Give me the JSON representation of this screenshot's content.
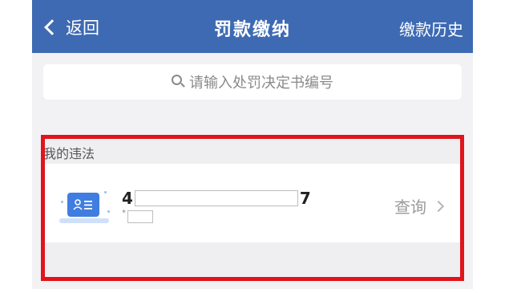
{
  "header": {
    "back_label": "返回",
    "title": "罚款缴纳",
    "history_label": "缴款历史",
    "background_color": "#3e6ab3"
  },
  "search": {
    "placeholder": "请输入处罚决定书编号",
    "icon": "search-icon"
  },
  "violations": {
    "section_title": "我的违法",
    "item": {
      "plate_prefix": "4",
      "plate_suffix": "7",
      "sub_prefix": "*",
      "query_label": "查询",
      "icon": "id-card-icon"
    }
  },
  "annotation": {
    "highlight_color": "#e0141c"
  }
}
